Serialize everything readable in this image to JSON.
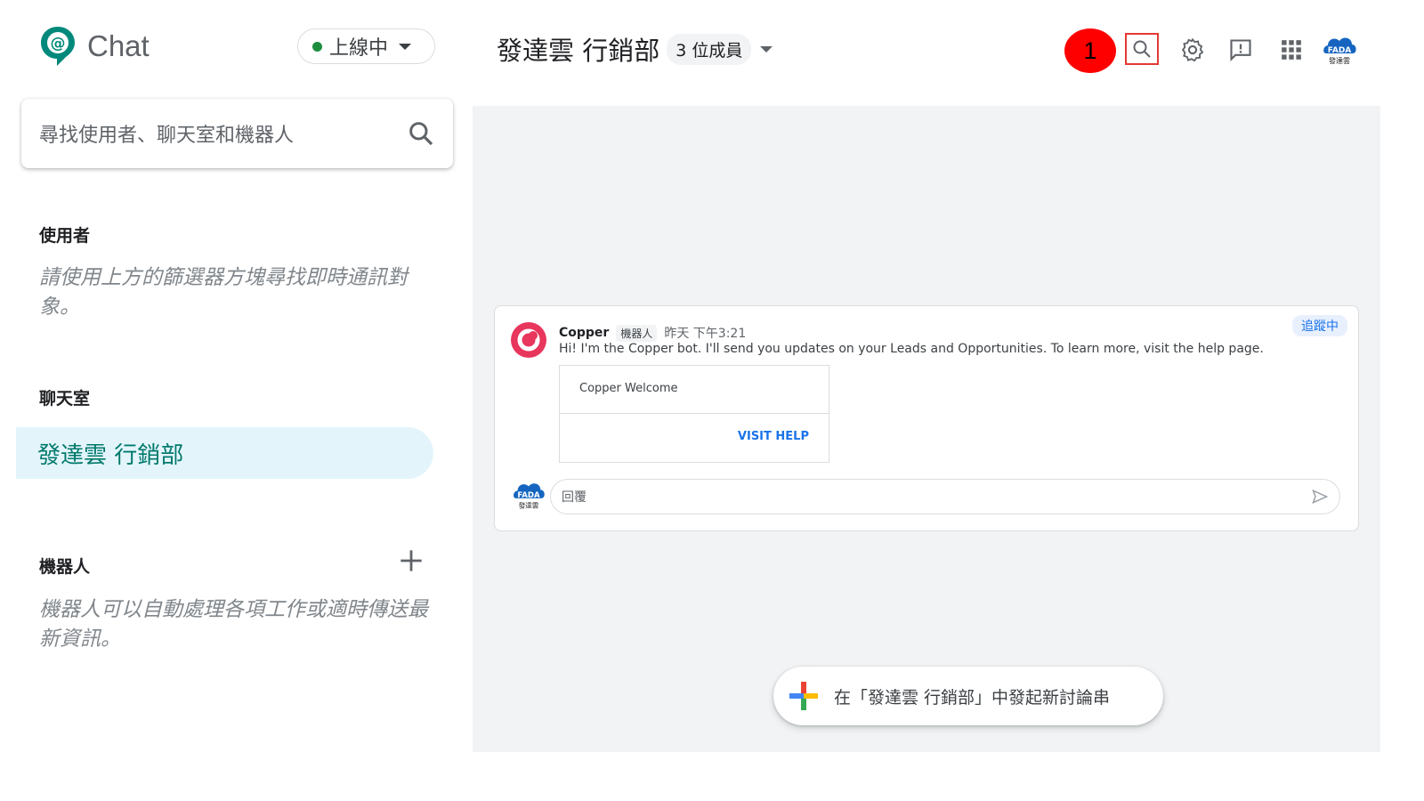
{
  "app": {
    "title": "Chat",
    "logo_icon": "google-chat-logo-icon"
  },
  "status": {
    "label": "上線中",
    "color": "#1e8e3e"
  },
  "room_header": {
    "name": "發達雲 行銷部",
    "members": "3 位成員"
  },
  "header_actions": {
    "annotation_marker": "1",
    "icons": [
      "search-icon",
      "settings-gear-icon",
      "feedback-icon",
      "apps-grid-icon",
      "account-avatar"
    ],
    "avatar_text": "FADA",
    "avatar_subtext": "發達雲"
  },
  "sidebar": {
    "search_placeholder": "尋找使用者、聊天室和機器人",
    "users": {
      "title": "使用者",
      "hint": "請使用上方的篩選器方塊尋找即時通訊對象。"
    },
    "rooms": {
      "title": "聊天室",
      "items": [
        {
          "label": "發達雲 行銷部",
          "selected": true
        }
      ]
    },
    "bots": {
      "title": "機器人",
      "hint": "機器人可以自動處理各項工作或適時傳送最新資訊。"
    }
  },
  "thread": {
    "sender": "Copper",
    "bot_tag": "機器人",
    "time": "昨天 下午3:21",
    "follow_label": "追蹤中",
    "body": "Hi! I'm the Copper bot. I'll send you updates on your Leads and Opportunities. To learn more, visit the help page.",
    "widget": {
      "title": "Copper Welcome",
      "button": "VISIT HELP"
    },
    "reply_placeholder": "回覆",
    "brand_color": "#e8365d"
  },
  "new_thread": {
    "label": "在「發達雲 行銷部」中發起新討論串"
  }
}
